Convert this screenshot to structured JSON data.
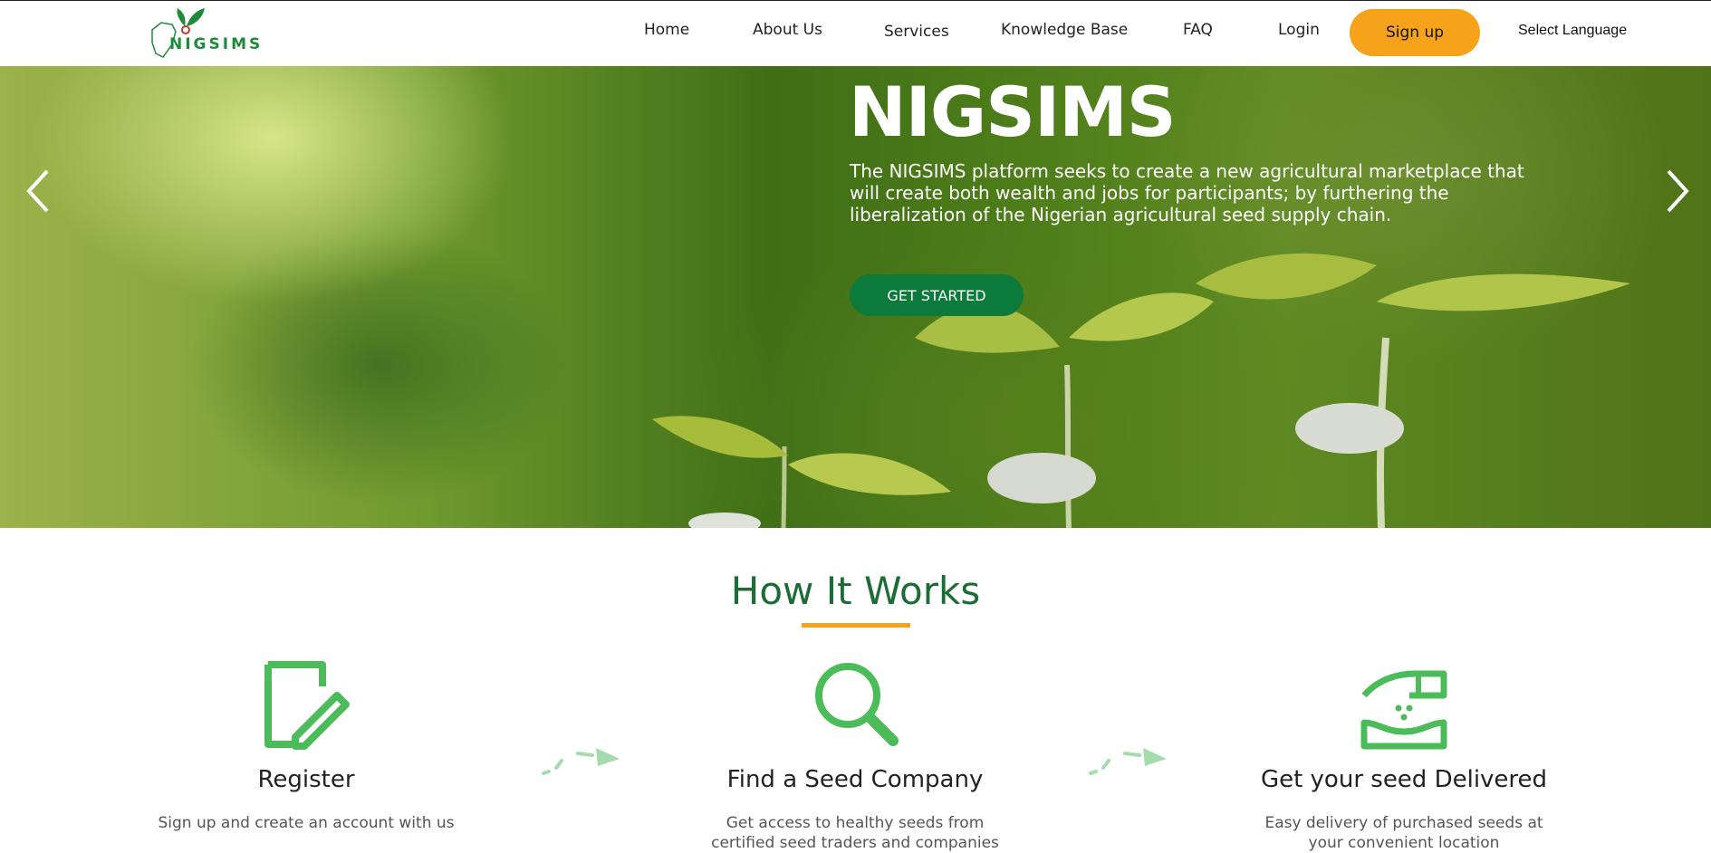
{
  "header": {
    "logo_text": "NIGSIMS",
    "nav": [
      "Home",
      "About Us",
      "Services",
      "Knowledge Base",
      "FAQ",
      "Login"
    ],
    "signup_label": "Sign up",
    "language_label": "Select Language"
  },
  "hero": {
    "title": "NIGSIMS",
    "description": "The NIGSIMS platform seeks to create a new agricultural marketplace that will create both wealth and jobs for participants; by furthering the liberalization of the Nigerian agricultural seed supply chain.",
    "cta_label": "GET STARTED",
    "prev_icon": "chevron-left-icon",
    "next_icon": "chevron-right-icon"
  },
  "how_it_works": {
    "title": "How It Works",
    "steps": [
      {
        "icon": "register-document-pencil-icon",
        "title": "Register",
        "desc": "Sign up and create an account with us"
      },
      {
        "icon": "search-magnifier-icon",
        "title": "Find a Seed Company",
        "desc": "Get access to healthy seeds from certified seed traders and companies"
      },
      {
        "icon": "seed-delivery-hand-icon",
        "title": "Get your seed Delivered",
        "desc": "Easy delivery of purchased seeds at your convenient location"
      }
    ]
  },
  "colors": {
    "brand_green": "#1d6b35",
    "icon_green": "#4cbc5a",
    "accent_orange": "#f7a21b",
    "cta_green": "#0c7a3a"
  }
}
